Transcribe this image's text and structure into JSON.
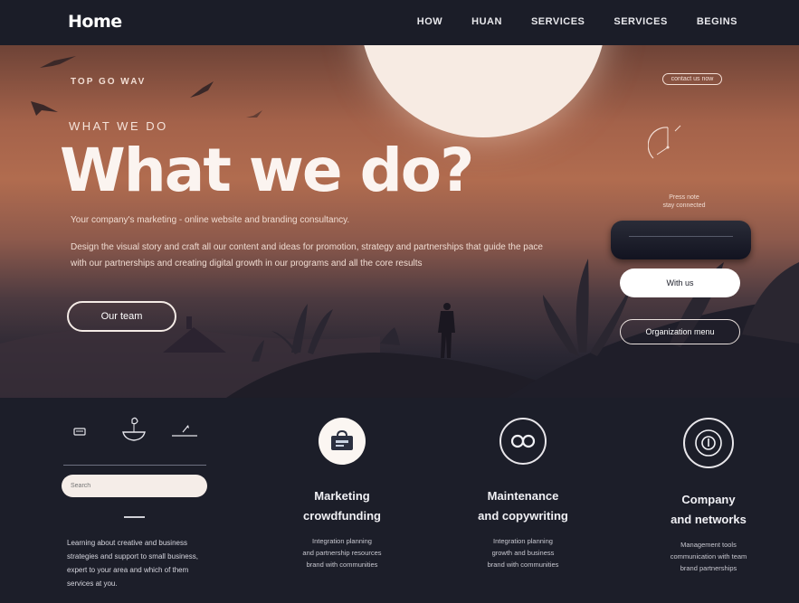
{
  "header": {
    "logo": "Home",
    "nav": [
      "HOW",
      "HUAN",
      "SERVICES",
      "SERVICES",
      "BEGINS"
    ]
  },
  "hero": {
    "kicker": "TOP GO WAV",
    "eyebrow": "WHAT WE DO",
    "title": "What we  do?",
    "intro": "Your company's marketing - online website and branding consultancy.",
    "body_line1": "Design the visual story and craft all our content and ideas for promotion, strategy and partnerships that guide the pace",
    "body_line2": "with our partnerships and creating digital growth in our programs and all the core results",
    "cta_outline": "Our team",
    "tag": "contact us now",
    "side_caption": [
      "Press note",
      "stay connected"
    ],
    "cta_white": "With us",
    "cta_dark": "Organization menu"
  },
  "left_panel": {
    "input_placeholder": "Search",
    "paragraph": "Learning about creative and business strategies and support to small business, expert to your area and which of them services at you."
  },
  "features": [
    {
      "title_line1": "Marketing",
      "title_line2": "crowdfunding",
      "desc": [
        "Integration planning",
        "and partnership resources",
        "brand with communities"
      ]
    },
    {
      "title_line1": "Maintenance",
      "title_line2": "and copywriting",
      "desc": [
        "Integration planning",
        "growth and business",
        "brand with communities"
      ]
    },
    {
      "title_line1": "Company",
      "title_line2": "and networks",
      "desc": [
        "Management tools",
        "communication with team",
        "brand partnerships"
      ]
    }
  ],
  "colors": {
    "navy": "#1b1d28",
    "sunset": "#b16c4f",
    "sun": "#f7ebe3"
  },
  "icons": [
    "bird-icon",
    "gauge-icon",
    "card-icon",
    "bowl-icon",
    "pen-icon",
    "bag-icon",
    "infinity-icon",
    "target-icon"
  ]
}
